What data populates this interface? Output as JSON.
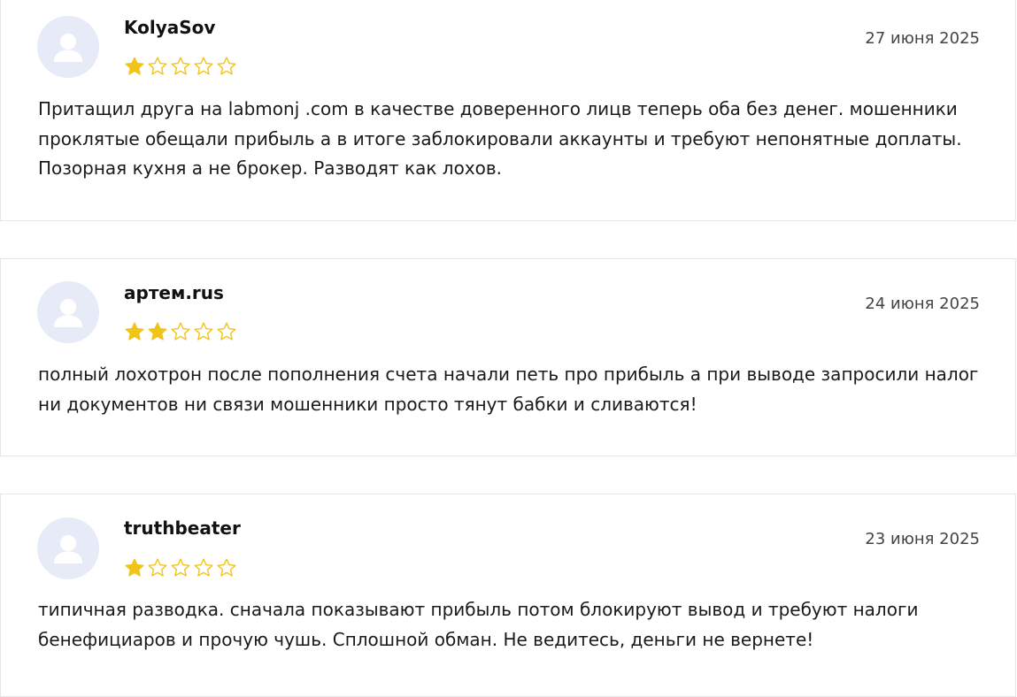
{
  "colors": {
    "star_filled": "#f0c419",
    "star_empty_stroke": "#f0c419",
    "avatar_bg": "#e6ebf7",
    "avatar_fg": "#ffffff",
    "border": "#e6e6e6"
  },
  "reviews": [
    {
      "author": "KolyaSov",
      "date": "27 июня 2025",
      "rating": 1,
      "max_rating": 5,
      "text": "Притащил друга на labmonj .com в качестве доверенного лицв теперь оба без денег. мошенники проклятые обещали прибыль а в итоге заблокировали аккаунты и требуют непонятные доплаты. Позорная кухня а не брокер. Разводят как лохов.",
      "avatar_icon": "user-silhouette-icon"
    },
    {
      "author": "артем.rus",
      "date": "24 июня 2025",
      "rating": 2,
      "max_rating": 5,
      "text": "полный лохотрон после пополнения счета начали петь про прибыль а при выводе запросили налог ни документов ни связи мошенники просто тянут бабки и сливаются!",
      "avatar_icon": "user-silhouette-icon"
    },
    {
      "author": "truthbeater",
      "date": "23 июня 2025",
      "rating": 1,
      "max_rating": 5,
      "text": "типичная разводка. сначала показывают прибыль потом блокируют вывод и требуют налоги бенефициаров и прочую чушь. Сплошной обман. Не ведитесь, деньги не вернете!",
      "avatar_icon": "user-silhouette-icon"
    }
  ]
}
